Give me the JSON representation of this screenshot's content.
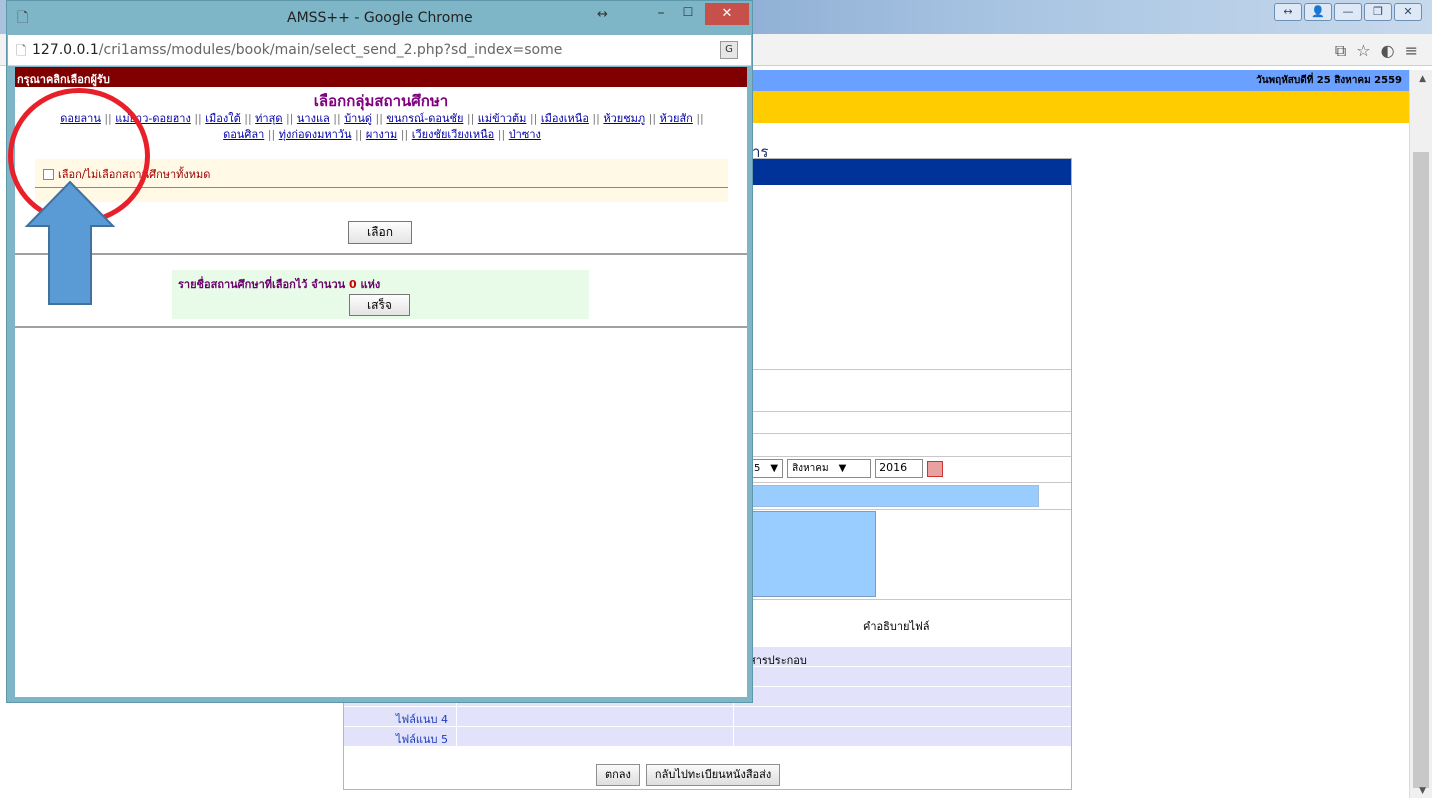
{
  "background": {
    "date_text": "วันพฤหัสบดีที่ 25 สิงหาคม 2559",
    "heading_fragment": "าร",
    "date_day_fragment": "5",
    "date_month": "สิงหาคม",
    "date_year": "2016",
    "file_desc_label": "คำอธิบายไฟล์",
    "attachment_fragment": "สารประกอบ",
    "attach_rows": [
      "",
      "",
      "",
      "ไฟล์แนบ 4",
      "ไฟล์แนบ 5"
    ],
    "ok_button": "ตกลง",
    "back_button": "กลับไปทะเบียนหนังสือส่ง"
  },
  "popup": {
    "title": "AMSS++ - Google Chrome",
    "url_host": "127.0.0.1",
    "url_path": "/cri1amss/modules/book/main/select_send_2.php?sd_index=some",
    "header": "กรุณาคลิกเลือกผู้รับ",
    "group_title": "เลือกกลุ่มสถานศึกษา",
    "groups": [
      "ดอยลาน",
      "แม่ยาว-ดอยฮาง",
      "เมืองใต้",
      "ท่าสุด",
      "นางแล",
      "บ้านดู่",
      "ขนกรณ์-ดอนชัย",
      "แม่ข้าวต้ม",
      "เมืองเหนือ",
      "ห้วยชมภู",
      "ห้วยสัก",
      "ดอนศิลา",
      "ทุ่งก่อดงมหาวัน",
      "ผางาม",
      "เวียงชัยเวียงเหนือ",
      "ป่าซาง"
    ],
    "select_all_label": "เลือก/ไม่เลือกสถานศึกษาทั้งหมด",
    "choose_button": "เลือก",
    "selected_prefix": "รายชื่อสถานศึกษาที่เลือกไว้ จำนวน",
    "selected_count": "0",
    "selected_suffix": "แห่ง",
    "done_button": "เสร็จ"
  },
  "annotation": {
    "circle_color": "#e8202a",
    "arrow_color": "#5b9bd5"
  },
  "colors": {
    "popup_header": "#800000",
    "group_title": "#800080",
    "link": "#0000aa"
  }
}
